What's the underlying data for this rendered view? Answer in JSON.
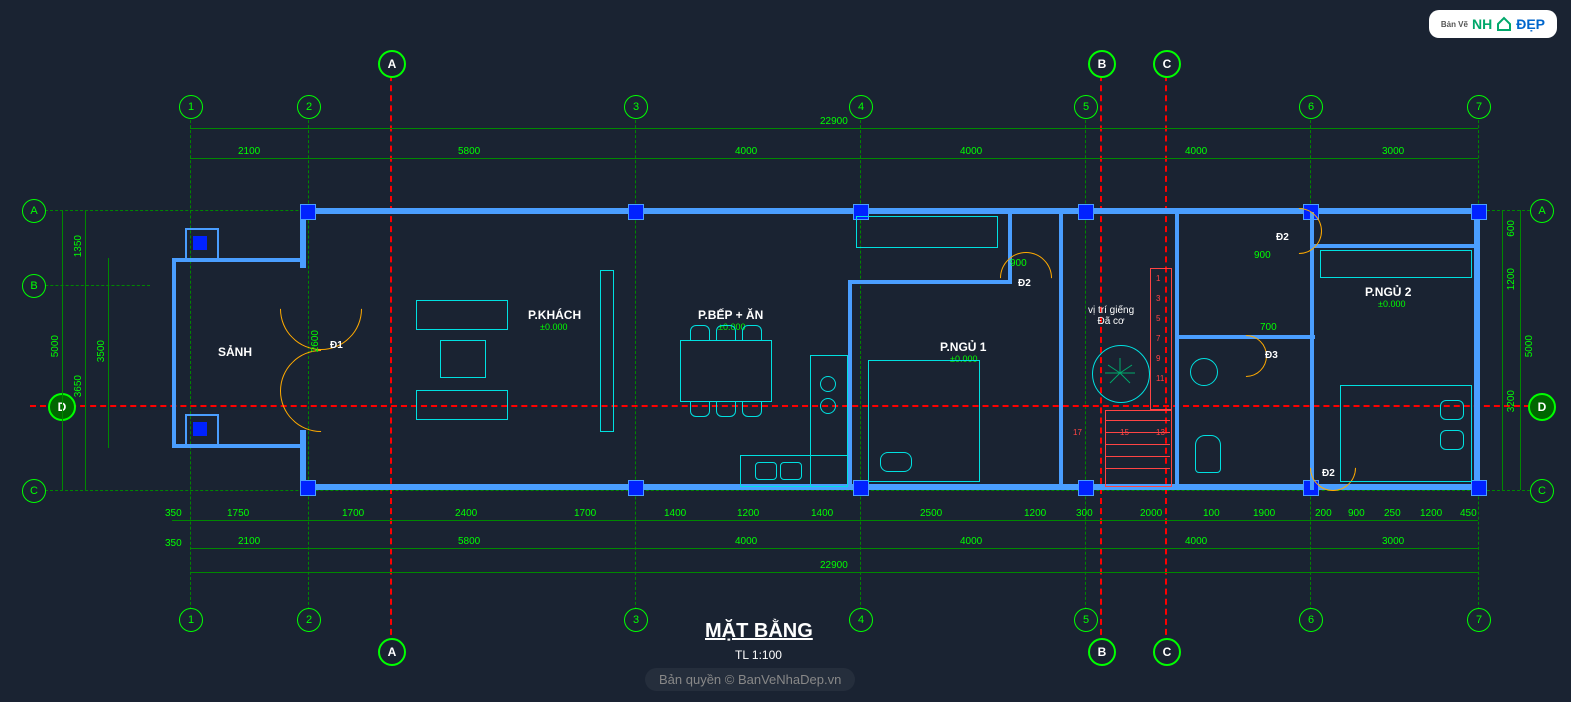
{
  "title": "MẶT BẰNG",
  "scale": "TL 1:100",
  "watermark": "Bản quyền © BanVeNhaDep.vn",
  "logo": {
    "t1": "Bản Vẽ",
    "t2": "NH",
    "t3": "ĐẸP"
  },
  "grids_v": [
    "1",
    "2",
    "3",
    "4",
    "5",
    "6",
    "7"
  ],
  "grids_h": [
    "A",
    "B",
    "C"
  ],
  "sections": [
    "A",
    "B",
    "C",
    "D"
  ],
  "rooms": {
    "sanh": {
      "label": "SẢNH",
      "level": ""
    },
    "khach": {
      "label": "P.KHÁCH",
      "level": "±0.000"
    },
    "bep": {
      "label": "P.BẾP + ĂN",
      "level": "±0.000"
    },
    "ngu1": {
      "label": "P.NGỦ 1",
      "level": "±0.000"
    },
    "gieng": {
      "label": "vị trí giếng\nĐã cơ",
      "level": ""
    },
    "ngu2": {
      "label": "P.NGỦ 2",
      "level": "±0.000"
    }
  },
  "doors": {
    "d1": "Đ1",
    "d2": "Đ2",
    "d3": "Đ3"
  },
  "dims_top_overall": "22900",
  "dims_top": [
    "2100",
    "5800",
    "4000",
    "4000",
    "4000",
    "3000"
  ],
  "dims_bottom_overall": "22900",
  "dims_bottom_grid": [
    "2100",
    "5800",
    "4000",
    "4000",
    "4000",
    "3000"
  ],
  "dims_bottom_detail": [
    "350",
    "1750",
    "1700",
    "2400",
    "1700",
    "1400",
    "1200",
    "1400",
    "2500",
    "1200",
    "300",
    "2000",
    "100",
    "1900",
    "200",
    "900",
    "250",
    "1200",
    "450"
  ],
  "dims_bottom_lead": "350",
  "dims_left_overall": "5000",
  "dims_left": [
    "1350",
    "3650"
  ],
  "dims_left_inner": [
    "3500"
  ],
  "dims_right_overall": "5000",
  "dims_right": [
    "600",
    "1200",
    "3200"
  ],
  "dims_internal": {
    "door_d1": "2600",
    "ngu1_900": "900",
    "gieng_900": "900",
    "wc_700": "700"
  },
  "stair_numbers": [
    "1",
    "3",
    "5",
    "7",
    "9",
    "11",
    "13",
    "15",
    "17"
  ]
}
